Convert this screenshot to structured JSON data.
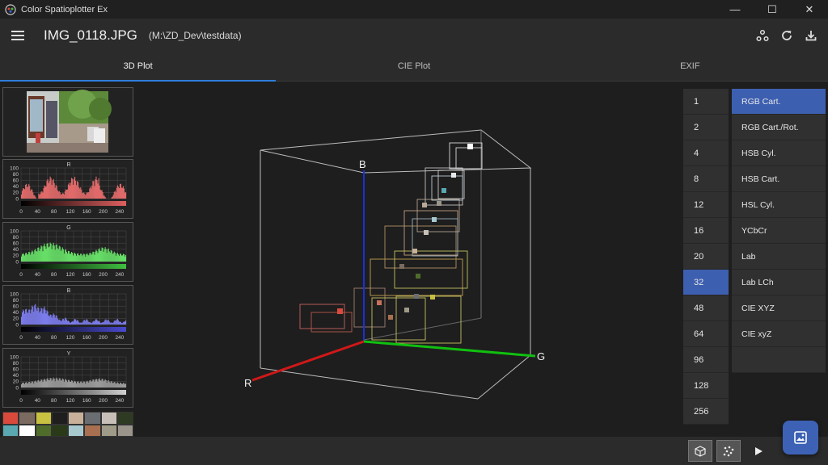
{
  "window": {
    "title": "Color Spatioplotter Ex",
    "controls": {
      "minimize": "—",
      "maximize": "☐",
      "close": "✕"
    }
  },
  "header": {
    "file_name": "IMG_0118.JPG",
    "file_path": "(M:\\ZD_Dev\\testdata)",
    "actions": [
      "share-nodes-icon",
      "refresh-icon",
      "download-icon"
    ]
  },
  "tabs": [
    {
      "label": "3D Plot",
      "active": true
    },
    {
      "label": "CIE Plot",
      "active": false
    },
    {
      "label": "EXIF",
      "active": false
    }
  ],
  "histograms": [
    {
      "channel": "R",
      "color": "#e06060",
      "bar_color": "#e06a6a"
    },
    {
      "channel": "G",
      "color": "#40c040",
      "bar_color": "#66dd66"
    },
    {
      "channel": "B",
      "color": "#4a4ad0",
      "bar_color": "#7b7bea"
    },
    {
      "channel": "Y",
      "color": "#d0d0d0",
      "bar_color": "#9a9a9a"
    }
  ],
  "histogram_axes": {
    "y_ticks": [
      "100",
      "80",
      "60",
      "40",
      "20",
      "0"
    ],
    "x_ticks": [
      "0",
      "40",
      "80",
      "120",
      "160",
      "200",
      "240"
    ]
  },
  "swatches": [
    "#d94a3d",
    "#7a6a60",
    "#c8c040",
    "#1e1e1e",
    "#c8b09a",
    "#6a6e72",
    "#c8c0b8",
    "#2e3a22",
    "#5aa8b2",
    "#ffffff",
    "#506c2a",
    "#2a3a18",
    "#a8c8d0",
    "#a87050",
    "#a09a88",
    "#9a948a"
  ],
  "plot": {
    "axis_labels": {
      "r": "R",
      "g": "G",
      "b": "B"
    },
    "axis_colors": {
      "r": "#d01818",
      "g": "#10c010",
      "b": "#1a30d8"
    }
  },
  "bin_counts": [
    {
      "label": "1",
      "selected": false
    },
    {
      "label": "2",
      "selected": false
    },
    {
      "label": "4",
      "selected": false
    },
    {
      "label": "8",
      "selected": false
    },
    {
      "label": "12",
      "selected": false
    },
    {
      "label": "16",
      "selected": false
    },
    {
      "label": "20",
      "selected": false
    },
    {
      "label": "32",
      "selected": true
    },
    {
      "label": "48",
      "selected": false
    },
    {
      "label": "64",
      "selected": false
    },
    {
      "label": "96",
      "selected": false
    },
    {
      "label": "128",
      "selected": false
    },
    {
      "label": "256",
      "selected": false
    }
  ],
  "color_spaces": [
    {
      "label": "RGB Cart.",
      "selected": true
    },
    {
      "label": "RGB Cart./Rot.",
      "selected": false
    },
    {
      "label": "HSB Cyl.",
      "selected": false
    },
    {
      "label": "HSB Cart.",
      "selected": false
    },
    {
      "label": "HSL Cyl.",
      "selected": false
    },
    {
      "label": "YCbCr",
      "selected": false
    },
    {
      "label": "Lab",
      "selected": false
    },
    {
      "label": "Lab LCh",
      "selected": false
    },
    {
      "label": "CIE XYZ",
      "selected": false
    },
    {
      "label": "CIE xyZ",
      "selected": false
    },
    {
      "label": "",
      "selected": false
    }
  ],
  "accent_color": "#3d5fb0",
  "bottom_actions": [
    "cube-icon",
    "scatter-icon",
    "play-icon"
  ],
  "fab": "image-icon"
}
